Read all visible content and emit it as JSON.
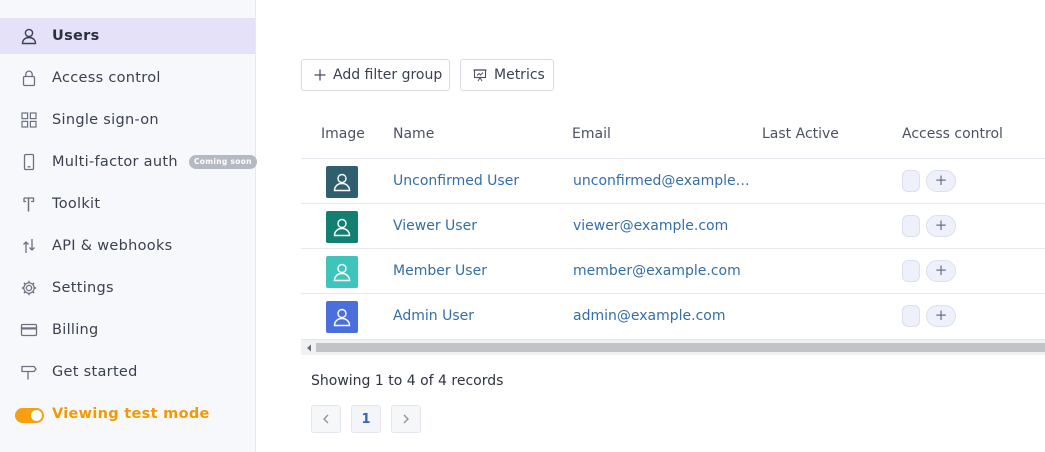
{
  "sidebar": {
    "items": [
      {
        "label": "Users",
        "icon": "user-icon",
        "active": true
      },
      {
        "label": "Access control",
        "icon": "lock-icon"
      },
      {
        "label": "Single sign-on",
        "icon": "grid-icon"
      },
      {
        "label": "Multi-factor auth",
        "icon": "phone-icon",
        "badge": "Coming soon"
      },
      {
        "label": "Toolkit",
        "icon": "hammer-icon"
      },
      {
        "label": "API & webhooks",
        "icon": "api-arrows-icon"
      },
      {
        "label": "Settings",
        "icon": "gear-icon"
      },
      {
        "label": "Billing",
        "icon": "credit-card-icon"
      },
      {
        "label": "Get started",
        "icon": "signpost-icon"
      }
    ],
    "test_mode": {
      "label": "Viewing test mode",
      "enabled": true,
      "color": "#f5a00f"
    }
  },
  "toolbar": {
    "filter_label": "Add filter group",
    "metrics_label": "Metrics"
  },
  "table": {
    "columns": [
      "Image",
      "Name",
      "Email",
      "Last Active",
      "Access control"
    ],
    "rows": [
      {
        "name": "Unconfirmed User",
        "email": "unconfirmed@example.com",
        "last_active": "",
        "avatar_color": "#2f5f6e"
      },
      {
        "name": "Viewer User",
        "email": "viewer@example.com",
        "last_active": "",
        "avatar_color": "#127f72"
      },
      {
        "name": "Member User",
        "email": "member@example.com",
        "last_active": "",
        "avatar_color": "#3ec4bb"
      },
      {
        "name": "Admin User",
        "email": "admin@example.com",
        "last_active": "",
        "avatar_color": "#4a6fdd"
      }
    ],
    "add_label": "+"
  },
  "footer": {
    "records_text": "Showing 1 to 4 of 4 records",
    "current_page": "1"
  },
  "colors": {
    "accent": "#e4e1f9",
    "link": "#336ea8",
    "warning": "#f29a00"
  }
}
